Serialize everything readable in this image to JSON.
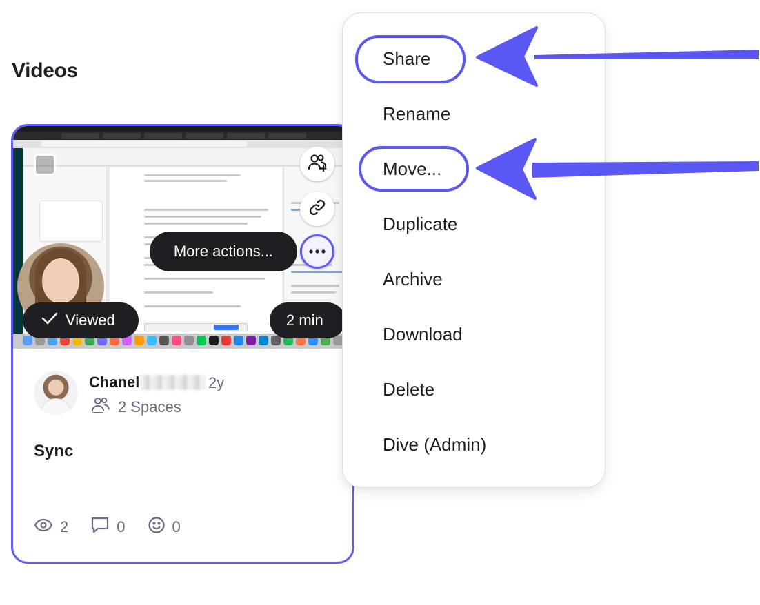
{
  "page": {
    "title": "Videos"
  },
  "card": {
    "tooltip": "More actions...",
    "viewed_label": "Viewed",
    "duration": "2 min",
    "author_name": "Chanel",
    "time_ago": "2y",
    "spaces_label": "2 Spaces",
    "title": "Sync",
    "stats": {
      "views": "2",
      "comments": "0",
      "reactions": "0"
    }
  },
  "menu": {
    "items": [
      "Share",
      "Rename",
      "Move...",
      "Duplicate",
      "Archive",
      "Download",
      "Delete",
      "Dive (Admin)"
    ]
  },
  "colors": {
    "accent": "#625df5",
    "annotation": "#5b57f2",
    "pill_bg": "#1f1f23",
    "muted_text": "#6e6a84"
  }
}
